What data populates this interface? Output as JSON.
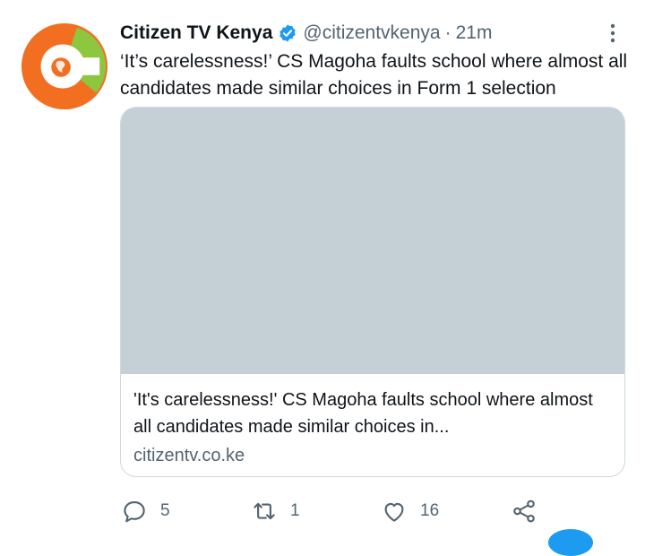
{
  "tweet": {
    "author_name": "Citizen TV Kenya",
    "handle": "@citizentvkenya",
    "separator": "·",
    "time": "21m",
    "text": "‘It’s carelessness!’ CS Magoha faults school where almost all candidates made similar choices in Form 1 selection",
    "verified": true
  },
  "card": {
    "title": "'It's carelessness!' CS Magoha faults school where almost all candidates made similar choices in...",
    "domain": "citizentv.co.ke",
    "image_placeholder_color": "#c4cfd6"
  },
  "actions": {
    "reply_count": "5",
    "retweet_count": "1",
    "like_count": "16"
  },
  "colors": {
    "logo_orange": "#f26f21",
    "logo_green": "#8dc63f",
    "verified_blue": "#1d9bf0",
    "text_secondary": "#536471"
  },
  "icons": [
    "citizen-tv-logo",
    "verified-badge-icon",
    "more-options-icon",
    "reply-icon",
    "retweet-icon",
    "like-icon",
    "share-icon"
  ]
}
